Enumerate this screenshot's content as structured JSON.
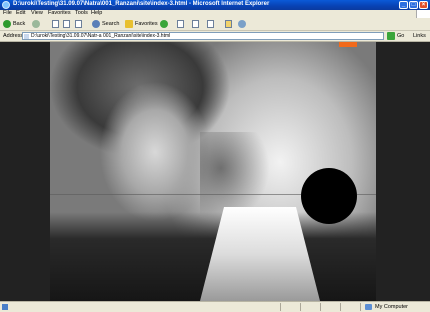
{
  "window": {
    "title": "D:\\uroki\\Testing\\31.09.07\\Natra\\001_Ranzani\\site\\index-3.html - Microsoft Internet Explorer",
    "minimize": "_",
    "maximize": "□",
    "close": "×"
  },
  "menu": [
    "File",
    "Edit",
    "View",
    "Favorites",
    "Tools",
    "Help"
  ],
  "toolbar": {
    "back_label": "Back",
    "search_label": "Search",
    "favorites_label": "Favorites"
  },
  "address": {
    "label": "Address",
    "value": "D:\\uroki\\Testing\\31.09.07\\Natr-a 001_Ranzani\\site\\index-3.html",
    "go_label": "Go",
    "links_label": "Links"
  },
  "status": {
    "zone": "My Computer"
  },
  "colors": {
    "accent_tab": "#f26a1b",
    "title_bar": "#0842b4"
  }
}
